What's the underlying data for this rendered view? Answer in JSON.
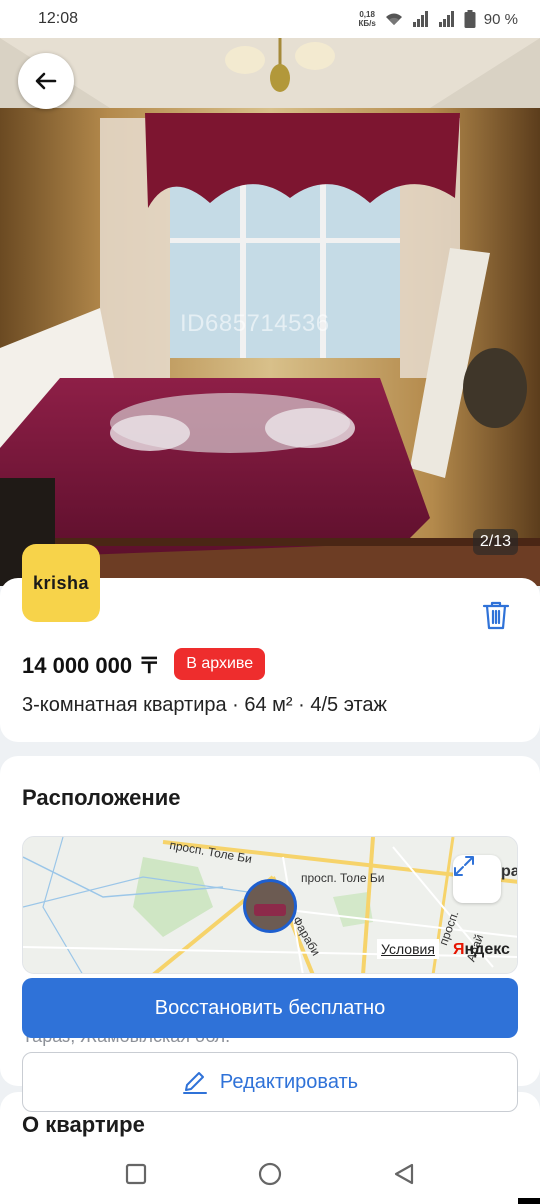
{
  "status_bar": {
    "time": "12:08",
    "net_speed_value": "0,18",
    "net_speed_unit": "КБ/s",
    "battery": "90 %"
  },
  "listing": {
    "watermark": "ID685714536",
    "photo_counter": "2/13",
    "brand": "krisha",
    "price": "14 000 000 〒",
    "status_badge": "В архиве",
    "summary": "3-комнатная квартира · 64 м² · 4/5 этаж"
  },
  "location": {
    "title": "Расположение",
    "map_labels": {
      "street1": "просп. Толе Би",
      "street2": "просп. Толе Би",
      "street3": "Фараби",
      "street4": "просп.",
      "street5": "Абай",
      "edge": "ра"
    },
    "terms": "Условия",
    "yandex_prefix": "Я",
    "yandex_rest": "ндекс",
    "address": "Тараз, Жамбылская обл."
  },
  "actions": {
    "restore": "Восстановить бесплатно",
    "edit": "Редактировать"
  },
  "about": {
    "title": "О квартире"
  },
  "colors": {
    "primary": "#2f72d8",
    "archive": "#ee2d2d",
    "brand": "#f7d34a"
  }
}
